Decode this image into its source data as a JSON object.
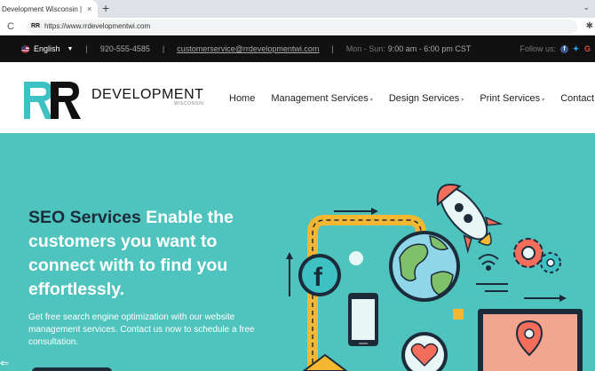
{
  "browser": {
    "tab_title": "Development Wisconsin | Sc",
    "tab_close": "×",
    "new_tab": "+",
    "chevron": "⌄",
    "reload": "C",
    "url": "https://www.rrdevelopmentwi.com",
    "favicon": "RR"
  },
  "infobar": {
    "language": "English",
    "phone": "920-555-4585",
    "email": "customerservice@rrdevelopmentwi.com",
    "hours_label": "Mon - Sun:",
    "hours_time": "9:00 am - 6:00 pm CST",
    "follow_label": "Follow us:",
    "separator": "|"
  },
  "logo": {
    "title": "DEVELOPMENT",
    "subtitle": "WISCONSIN"
  },
  "nav": {
    "items": [
      {
        "label": "Home"
      },
      {
        "label": "Management Services"
      },
      {
        "label": "Design Services"
      },
      {
        "label": "Print Services"
      },
      {
        "label": "Contact U"
      }
    ]
  },
  "hero": {
    "heading_highlight": "SEO Services",
    "heading_rest": " Enable the customers you want to connect with to find you effortlessly.",
    "subtext": "Get free search engine optimization with our website management services. Contact us now to schedule a free consultation."
  },
  "colors": {
    "teal": "#4fc3bd",
    "navy": "#1c2b3a",
    "brand_teal": "#3ec1c3",
    "yellow": "#f5b731",
    "coral": "#f26d5b"
  }
}
